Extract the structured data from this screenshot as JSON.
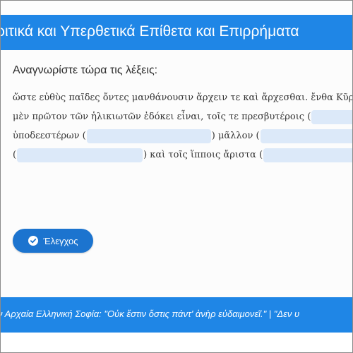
{
  "header": {
    "title": "ριτικά και Υπερθετικά Επίθετα και Επιρρήματα"
  },
  "exercise": {
    "instruction": "Αναγνωρίστε τώρα τις λέξεις:",
    "lines": [
      {
        "parts": [
          "ὥστε εὐθὺς παῖδες ὄντες μανθάνουσιν ἄρχειν τε καὶ ἄρχεσθαι. ἔνθα Κῦρ"
        ]
      },
      {
        "parts": [
          "μὲν πρῶτον τῶν ἡλικιωτῶν ἐδόκει εἶναι, τοῖς τε πρεσβυτέροις ("
        ]
      },
      {
        "parts": [
          "ὑποδεεστέρων (",
          ") μᾶλλον ("
        ]
      },
      {
        "parts": [
          "(",
          ") καὶ τοῖς ἵπποις ἄριστα ("
        ]
      }
    ]
  },
  "actions": {
    "check_label": "Έλεγχος"
  },
  "footer": {
    "ticker_text": "ν Αρχαία Ελληνική Σοφία: \"Οὐκ ἔστιν ὅστις πάντ' ἀνὴρ εὐδαιμονεῖ.\" | \"Δεν υ"
  },
  "colors": {
    "accent": "#1f86e6",
    "button": "#1c74cf",
    "blank_fill": "#dce9f9"
  },
  "icons": {
    "check": "check-circle-icon"
  }
}
